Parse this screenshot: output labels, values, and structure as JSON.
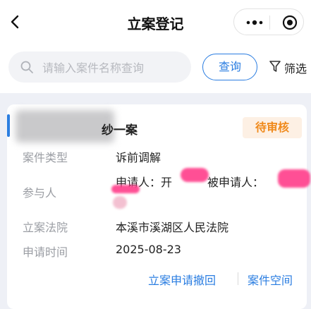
{
  "header": {
    "title": "立案登记"
  },
  "search": {
    "placeholder": "请输入案件名称查询",
    "button_label": "查询",
    "filter_label": "筛选"
  },
  "case": {
    "title_suffix": "纱一案",
    "status": "待审核",
    "fields": {
      "type_label": "案件类型",
      "type_value": "诉前调解",
      "party_label": "参与人",
      "applicant_prefix": "申请人：",
      "applicant_partial": "开",
      "respondent_prefix": "被申请人：",
      "court_label": "立案法院",
      "court_value": "本溪市溪湖区人民法院",
      "date_label": "申请时间",
      "date_value": "2025-08-23"
    },
    "actions": {
      "withdraw_label": "立案申请撤回",
      "space_label": "案件空间"
    }
  },
  "colors": {
    "accent": "#2a7de1",
    "status_text": "#f08a1c",
    "status_bg": "#fdf0e4"
  }
}
